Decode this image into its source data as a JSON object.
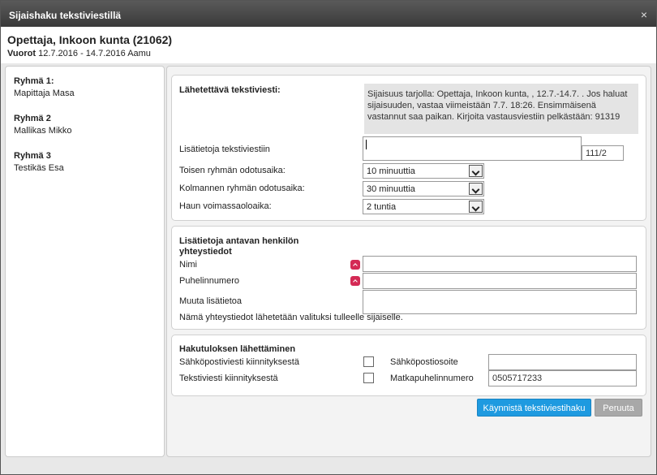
{
  "window": {
    "title": "Sijaishaku tekstiviestillä",
    "close_glyph": "×"
  },
  "header": {
    "name": "Opettaja, Inkoon kunta (21062)",
    "shifts_label": "Vuorot",
    "shifts_value": "12.7.2016 - 14.7.2016 Aamu"
  },
  "sidebar": {
    "groups": [
      {
        "title": "Ryhmä 1:",
        "name": "Mapittaja Masa"
      },
      {
        "title": "Ryhmä 2",
        "name": "Mallikas Mikko"
      },
      {
        "title": "Ryhmä 3",
        "name": "Testikäs Esa"
      }
    ]
  },
  "message": {
    "label": "Lähetettävä tekstiviesti:",
    "text": "Sijaisuus tarjolla: Opettaja, Inkoon kunta, , 12.7.-14.7. . Jos haluat sijaisuuden, vastaa viimeistään 7.7. 18:26. Ensimmäisenä vastannut saa paikan. Kirjoita vastausviestiin pelkästään: 91319",
    "extra_label": "Lisätietoja tekstiviestiin",
    "extra_value": "",
    "char_counter": "111/2",
    "second_wait_label": "Toisen ryhmän odotusaika:",
    "second_wait_value": "10 minuuttia",
    "third_wait_label": "Kolmannen ryhmän odotusaika:",
    "third_wait_value": "30 minuuttia",
    "validity_label": "Haun voimassaoloaika:",
    "validity_value": "2 tuntia"
  },
  "contact": {
    "heading": "Lisätietoja antavan henkilön yhteystiedot",
    "name_label": "Nimi",
    "name_value": "",
    "phone_label": "Puhelinnumero",
    "phone_value": "",
    "other_label": "Muuta lisätietoa",
    "other_value": "",
    "note": "Nämä yhteystiedot lähetetään valituksi tulleelle sijaiselle."
  },
  "results": {
    "heading": "Hakutuloksen lähettäminen",
    "email_notify_label": "Sähköpostiviesti kiinnityksestä",
    "email_notify_checked": false,
    "email_label": "Sähköpostiosoite",
    "email_value": "",
    "sms_notify_label": "Tekstiviesti kiinnityksestä",
    "sms_notify_checked": false,
    "mobile_label": "Matkapuhelinnumero",
    "mobile_value": "0505717233"
  },
  "actions": {
    "start_label": "Käynnistä tekstiviestihaku",
    "cancel_label": "Peruuta"
  },
  "colors": {
    "primary_button": "#1e9ae0",
    "secondary_button": "#a8a8a8",
    "required_marker": "#d42a55",
    "titlebar": "#4a4a4a"
  },
  "icons": {
    "close": "close-icon",
    "required": "required-marker-icon",
    "dropdown": "chevron-down-icon"
  }
}
